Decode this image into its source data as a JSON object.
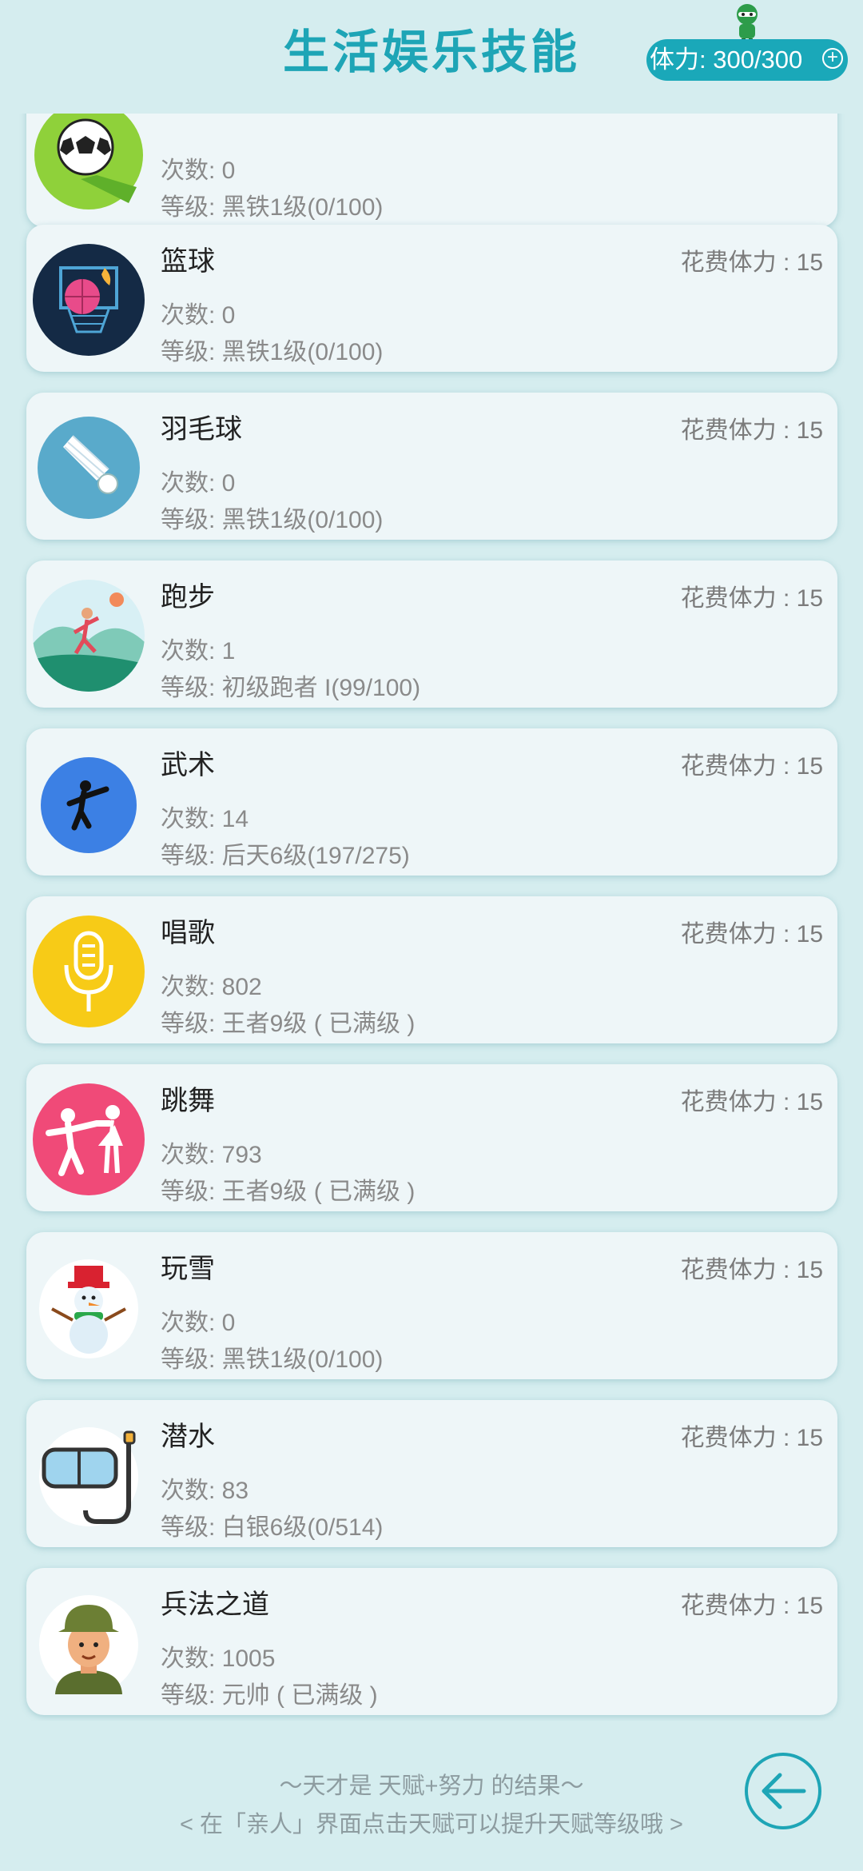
{
  "header": {
    "title": "生活娱乐技能",
    "stamina_label": "体力: 300/300"
  },
  "cost_label": "花费体力 : 15",
  "skills": [
    {
      "icon": "soccer-icon",
      "name": "",
      "count": "次数: 0",
      "level": "等级: 黑铁1级(0/100)"
    },
    {
      "icon": "basketball-icon",
      "name": "篮球",
      "count": "次数: 0",
      "level": "等级: 黑铁1级(0/100)"
    },
    {
      "icon": "badminton-icon",
      "name": "羽毛球",
      "count": "次数: 0",
      "level": "等级: 黑铁1级(0/100)"
    },
    {
      "icon": "running-icon",
      "name": "跑步",
      "count": "次数: 1",
      "level": "等级: 初级跑者 I(99/100)"
    },
    {
      "icon": "martial-arts-icon",
      "name": "武术",
      "count": "次数: 14",
      "level": "等级: 后天6级(197/275)"
    },
    {
      "icon": "microphone-icon",
      "name": "唱歌",
      "count": "次数: 802",
      "level": "等级: 王者9级 ( 已满级 )"
    },
    {
      "icon": "dancing-icon",
      "name": "跳舞",
      "count": "次数: 793",
      "level": "等级: 王者9级 ( 已满级 )"
    },
    {
      "icon": "snowman-icon",
      "name": "玩雪",
      "count": "次数: 0",
      "level": "等级: 黑铁1级(0/100)"
    },
    {
      "icon": "diving-mask-icon",
      "name": "潜水",
      "count": "次数: 83",
      "level": "等级: 白银6级(0/514)"
    },
    {
      "icon": "soldier-icon",
      "name": "兵法之道",
      "count": "次数: 1005",
      "level": "等级: 元帅 ( 已满级 )"
    }
  ],
  "footer": {
    "line1": "～天才是 天赋+努力 的结果～",
    "line2": "< 在「亲人」界面点击天赋可以提升天赋等级哦 >"
  }
}
